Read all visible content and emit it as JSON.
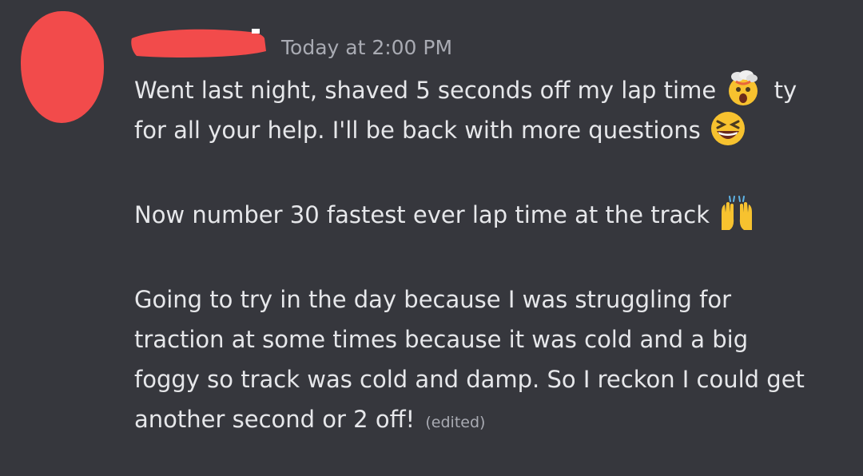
{
  "message": {
    "timestamp": "Today at 2:00 PM",
    "paragraph1": {
      "line1_text": "Went last night, shaved 5 seconds off my lap time",
      "line1_emoji": "exploding-head-icon",
      "line1_tail": "ty",
      "line2_text": "for all your help. I'll be back with more questions",
      "line2_emoji": "laughing-squinting-face-icon"
    },
    "paragraph2": {
      "text": "Now number 30 fastest ever lap time at the track",
      "emoji": "raising-hands-icon"
    },
    "paragraph3": {
      "line1": "Going to try in the day because I was struggling for",
      "line2": "traction at some times because it was cold and a big",
      "line3": "foggy so track was cold and damp. So I reckon I could get",
      "line4": "another second or 2 off!",
      "edited_label": "(edited)"
    }
  },
  "colors": {
    "background": "#36373d",
    "text": "#e6e7ea",
    "muted": "#a9abb3",
    "redaction": "#f24b4b"
  }
}
